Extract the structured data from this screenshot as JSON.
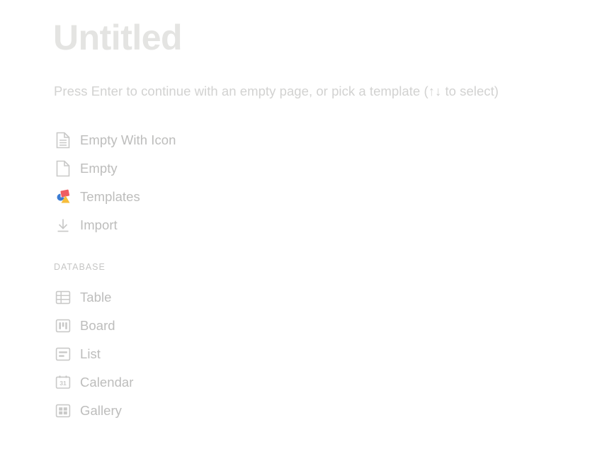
{
  "page": {
    "title": "Untitled",
    "hint": "Press Enter to continue with an empty page, or pick a template (↑↓ to select)"
  },
  "options": [
    {
      "label": "Empty With Icon",
      "icon": "document-lines-icon"
    },
    {
      "label": "Empty",
      "icon": "document-blank-icon"
    },
    {
      "label": "Templates",
      "icon": "templates-shapes-icon"
    },
    {
      "label": "Import",
      "icon": "download-arrow-icon"
    }
  ],
  "database": {
    "section_label": "DATABASE",
    "items": [
      {
        "label": "Table",
        "icon": "table-grid-icon"
      },
      {
        "label": "Board",
        "icon": "board-columns-icon"
      },
      {
        "label": "List",
        "icon": "list-lines-icon"
      },
      {
        "label": "Calendar",
        "icon": "calendar-31-icon",
        "day_number": "31"
      },
      {
        "label": "Gallery",
        "icon": "gallery-grid-icon"
      }
    ]
  },
  "colors": {
    "background": "#ffffff",
    "title_text": "#e4e4e2",
    "hint_text": "#d2d2d1",
    "item_text": "#bdbdbc",
    "section_text": "#c6c6c5",
    "icon_gray": "#c9c9c8",
    "template_blue": "#3b7cd3",
    "template_red": "#ef5d62",
    "template_yellow": "#f6bd3b"
  }
}
